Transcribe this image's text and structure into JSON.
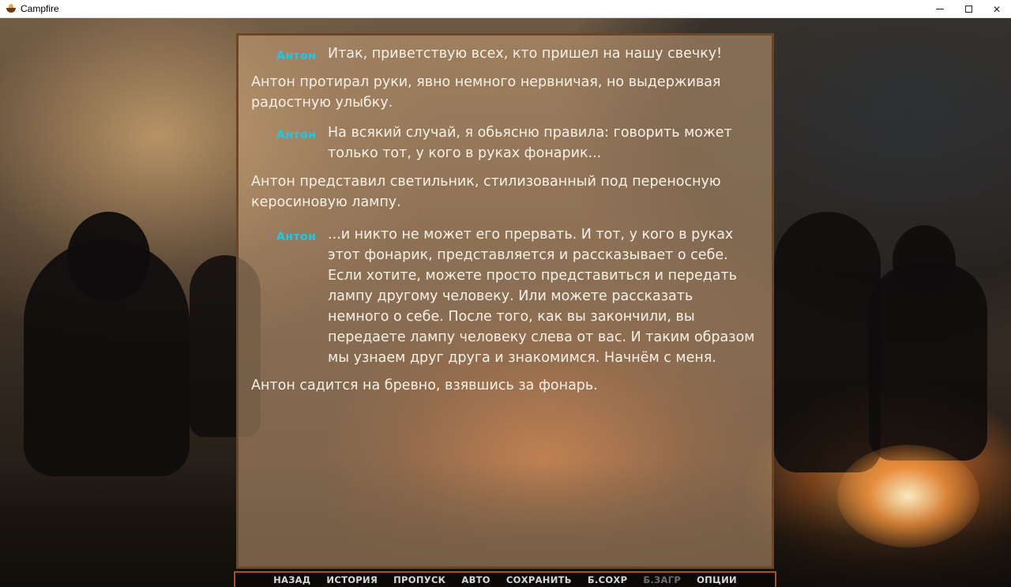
{
  "window": {
    "title": "Campfire",
    "minimize_glyph": "",
    "maximize_glyph": "",
    "close_glyph": "✕"
  },
  "dialogue": [
    {
      "kind": "speech",
      "speaker": "Антон",
      "text": "Итак, приветствую всех, кто пришел на нашу свечку!"
    },
    {
      "kind": "narration",
      "text": "Антон протирал руки, явно немного нервничая, но выдерживая радостную улыбку."
    },
    {
      "kind": "speech",
      "speaker": "Антон",
      "text": "На всякий случай, я обьясню правила: говорить может только тот, у кого в руках фонарик..."
    },
    {
      "kind": "narration",
      "text": "Антон представил светильник, стилизованный под переносную керосиновую лампу."
    },
    {
      "kind": "speech",
      "speaker": "Антон",
      "text": "...и никто не может его прервать. И тот, у кого в руках этот фонарик, представляется и рассказывает о себе. Если хотите, можете просто представиться и передать лампу другому человеку. Или можете рассказать немного о себе. После того, как вы закончили, вы передаете лампу человеку слева от вас. И таким образом мы узнаем друг друга и знакомимся. Начнём с меня."
    },
    {
      "kind": "narration",
      "text": "Антон садится на бревно, взявшись за фонарь."
    }
  ],
  "quick_menu": [
    {
      "label": "НАЗАД",
      "enabled": true
    },
    {
      "label": "ИСТОРИЯ",
      "enabled": true
    },
    {
      "label": "ПРОПУСК",
      "enabled": true
    },
    {
      "label": "АВТО",
      "enabled": true
    },
    {
      "label": "СОХРАНИТЬ",
      "enabled": true
    },
    {
      "label": "Б.СОХР",
      "enabled": true
    },
    {
      "label": "Б.ЗАГР",
      "enabled": false
    },
    {
      "label": "ОПЦИИ",
      "enabled": true
    }
  ],
  "colors": {
    "speaker_name": "#1ec8e8",
    "panel_border": "#6a4626",
    "quickmenu_border": "#a4521e"
  }
}
